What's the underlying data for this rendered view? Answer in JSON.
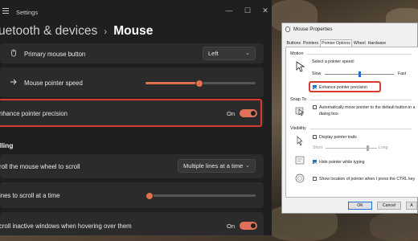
{
  "settings": {
    "app_title": "Settings",
    "breadcrumb": {
      "parent": "uetooth & devices",
      "separator": "›",
      "current": "Mouse"
    },
    "window_controls": {
      "minimize": "—",
      "maximize": "☐",
      "close": "✕"
    },
    "rows": {
      "primary_button": {
        "label": "Primary mouse button",
        "value": "Left"
      },
      "pointer_speed": {
        "label": "Mouse pointer speed",
        "level": 0.48
      },
      "precision": {
        "label": "nhance pointer precision",
        "state": "On"
      }
    },
    "scrolling": {
      "heading": "lling",
      "wheel": {
        "label": "roll the mouse wheel to scroll",
        "value": "Multiple lines at a time"
      },
      "lines": {
        "label": "ines to scroll at a time",
        "level": 0.03
      },
      "inactive": {
        "label": "croll inactive windows when hovering over them",
        "state": "On"
      }
    },
    "accent_color": "#e0705a",
    "highlight_color": "#d83a2f"
  },
  "dialog": {
    "title": "Mouse Properties",
    "tabs": [
      "Buttons",
      "Pointers",
      "Pointer Options",
      "Wheel",
      "Hardware"
    ],
    "active_tab": "Pointer Options",
    "motion": {
      "heading": "Motion",
      "speed_label": "Select a pointer speed:",
      "slow": "Slow",
      "fast": "Fast",
      "speed_level": 0.5,
      "precision": {
        "label": "Enhance pointer precision",
        "checked": true
      }
    },
    "snap_to": {
      "heading": "Snap To",
      "line1": "Automatically move pointer to the default button in a",
      "line2": "dialog box",
      "checked": false
    },
    "visibility": {
      "heading": "Visibility",
      "trails": {
        "label": "Display pointer trails",
        "checked": false
      },
      "short": "Short",
      "long": "Long",
      "hide": {
        "label": "Hide pointer while typing",
        "checked": true
      },
      "ctrl": {
        "label": "Show location of pointer when I press the CTRL key",
        "checked": false
      }
    },
    "buttons": {
      "ok": "OK",
      "cancel": "Cancel",
      "apply": "A"
    }
  }
}
